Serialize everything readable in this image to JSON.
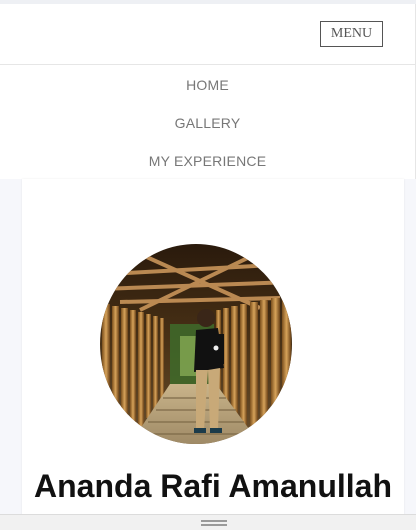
{
  "header": {
    "menu_label": "MENU"
  },
  "nav": {
    "items": [
      {
        "label": "HOME"
      },
      {
        "label": "GALLERY"
      },
      {
        "label": "MY EXPERIENCE"
      }
    ]
  },
  "profile": {
    "name": "Ananda Rafi Amanullah",
    "photo_icon": "profile-photo"
  },
  "colors": {
    "background": "#f6f7fb",
    "card": "#ffffff",
    "nav_text": "#777777",
    "name_text": "#111111",
    "menu_border": "#555555"
  }
}
